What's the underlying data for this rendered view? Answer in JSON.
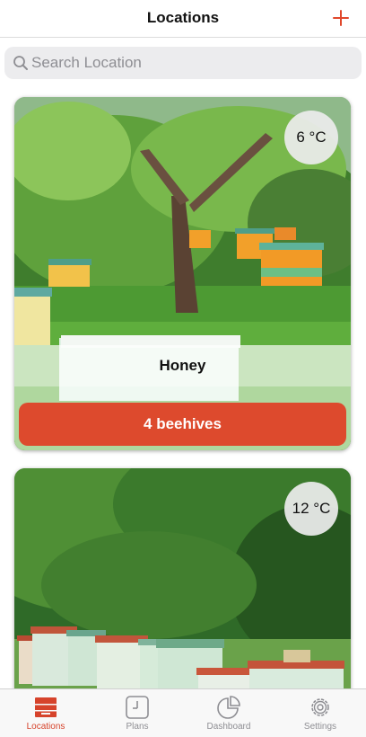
{
  "nav": {
    "title": "Locations"
  },
  "search": {
    "placeholder": "Search Location",
    "value": ""
  },
  "locations": [
    {
      "name": "Honey",
      "temperature": "6 °C",
      "hives_label": "4 beehives"
    },
    {
      "name": "",
      "temperature": "12 °C",
      "hives_label": ""
    }
  ],
  "tabs": [
    {
      "label": "Locations",
      "icon": "beehive-box-icon",
      "active": true
    },
    {
      "label": "Plans",
      "icon": "clock-icon",
      "active": false
    },
    {
      "label": "Dashboard",
      "icon": "pie-chart-icon",
      "active": false
    },
    {
      "label": "Settings",
      "icon": "gear-icon",
      "active": false
    }
  ],
  "colors": {
    "accent": "#dd4a2d",
    "inactive": "#8e8e93"
  }
}
